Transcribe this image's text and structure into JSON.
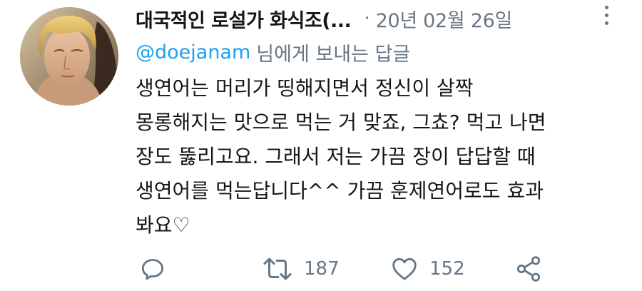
{
  "tweet": {
    "display_name": "대국적인 로설가 화식조(...",
    "separator": "·",
    "timestamp": "20년 02월 26일",
    "reply_to_handle": "@doejanam",
    "reply_suffix": "님에게 보내는 답글",
    "body_lines": [
      "생연어는 머리가 띵해지면서 정신이 살짝",
      "몽롱해지는 맛으로 먹는 거 맞죠, 그쵸? 먹고 나면",
      "장도 뚫리고요. 그래서 저는 가끔 장이 답답할 때",
      "생연어를 먹는답니다^^ 가끔 훈제연어로도 효과",
      "봐요♡"
    ]
  },
  "actions": {
    "reply": {
      "icon": "reply-icon"
    },
    "retweet": {
      "icon": "retweet-icon",
      "count": "187"
    },
    "like": {
      "icon": "heart-icon",
      "count": "152"
    },
    "share": {
      "icon": "share-icon"
    }
  },
  "colors": {
    "text": "#14171a",
    "muted": "#657786",
    "link": "#1da1f2"
  }
}
